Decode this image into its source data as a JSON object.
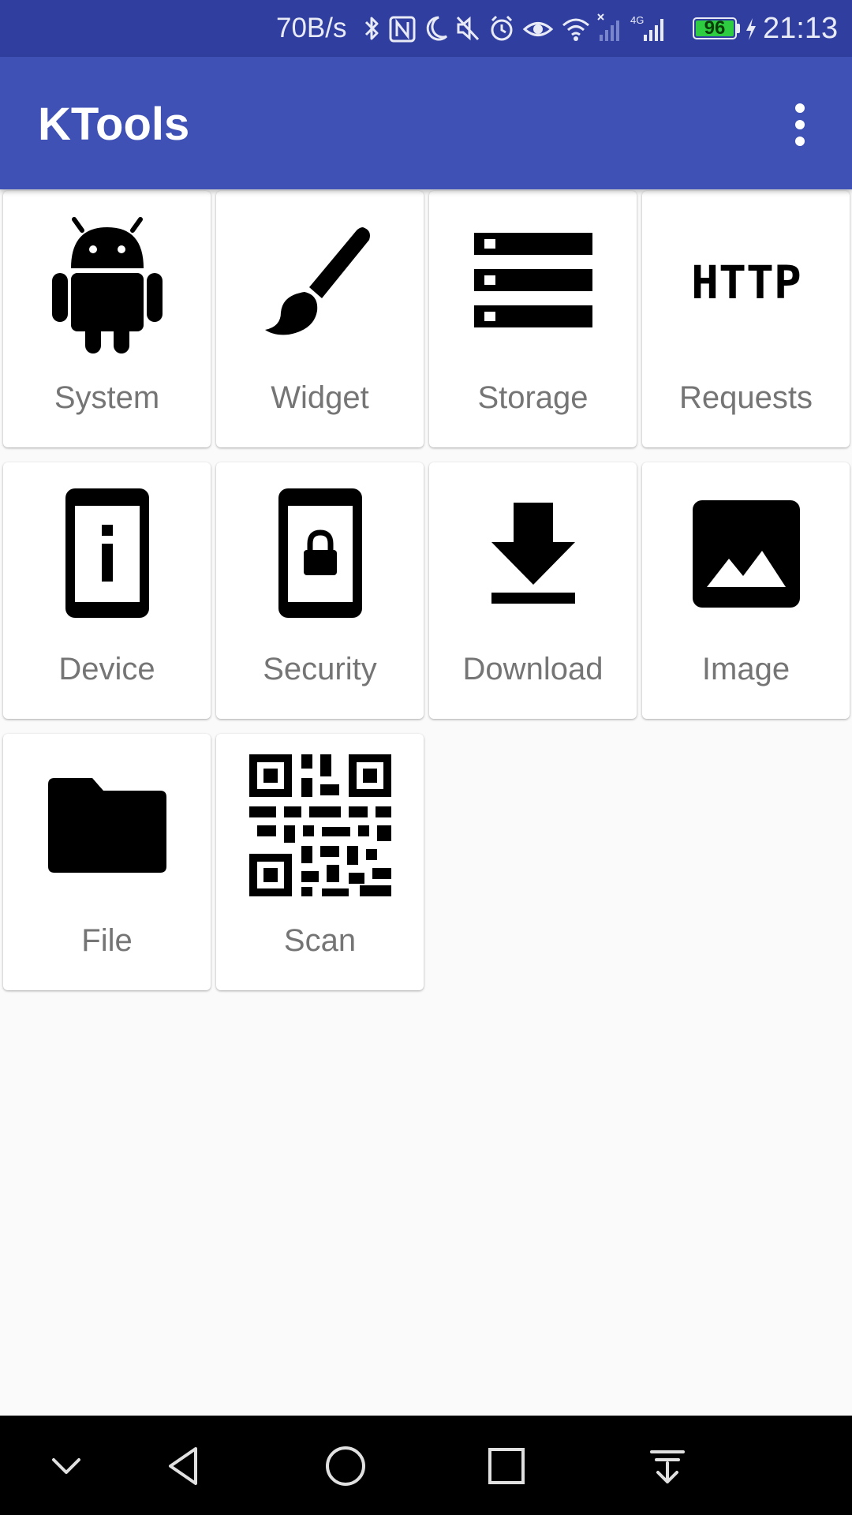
{
  "status_bar": {
    "net_speed": "70B/s",
    "battery_level": "96",
    "time": "21:13",
    "icons": [
      "bluetooth-icon",
      "nfc-icon",
      "moon-icon",
      "mute-icon",
      "alarm-icon",
      "eye-icon",
      "wifi-icon",
      "signal-no-sim-icon",
      "signal-4g-icon",
      "battery-icon",
      "charging-icon"
    ]
  },
  "app_bar": {
    "title": "KTools",
    "menu_icon": "more-vert-icon"
  },
  "tiles": [
    {
      "label": "System",
      "icon": "android-icon"
    },
    {
      "label": "Widget",
      "icon": "brush-icon"
    },
    {
      "label": "Storage",
      "icon": "storage-icon"
    },
    {
      "label": "Requests",
      "icon": "http-icon"
    },
    {
      "label": "Device",
      "icon": "phone-info-icon"
    },
    {
      "label": "Security",
      "icon": "phone-lock-icon"
    },
    {
      "label": "Download",
      "icon": "download-icon"
    },
    {
      "label": "Image",
      "icon": "image-icon"
    },
    {
      "label": "File",
      "icon": "folder-icon"
    },
    {
      "label": "Scan",
      "icon": "qr-code-icon"
    }
  ],
  "nav_bar": {
    "buttons": [
      "collapse-icon",
      "back-icon",
      "home-icon",
      "recents-icon",
      "notification-pull-icon"
    ]
  },
  "colors": {
    "status_bar": "#303f9f",
    "app_bar": "#3f51b5",
    "background": "#fafafa",
    "label": "#757575",
    "battery": "#2ecc40"
  }
}
